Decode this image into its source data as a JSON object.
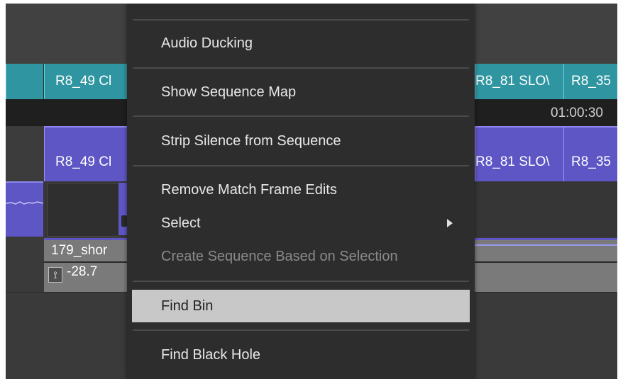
{
  "timeline": {
    "clips": {
      "v_left_1": "R8_49 Cl",
      "v_right_1a": "R8_81 SLO\\",
      "v_right_1b": "R8_35",
      "v_left_2": "R8_49 Cl",
      "v_right_2a": "R8_81 SLO\\",
      "v_right_2b": "R8_35",
      "audio_clip": "179_shor",
      "audio_gain": "-28.7"
    },
    "timecode": "01:00:30"
  },
  "context_menu": {
    "items": [
      {
        "label": "Audio Ducking",
        "state": "normal"
      },
      {
        "label": "Show Sequence Map",
        "state": "normal"
      },
      {
        "label": "Strip Silence from Sequence",
        "state": "normal"
      },
      {
        "label": "Remove Match Frame Edits",
        "state": "normal"
      },
      {
        "label": "Select",
        "state": "normal",
        "has_submenu": true
      },
      {
        "label": "Create Sequence Based on Selection",
        "state": "disabled"
      },
      {
        "label": "Find Bin",
        "state": "highlighted"
      },
      {
        "label": "Find Black Hole",
        "state": "normal"
      }
    ]
  },
  "colors": {
    "video_clip": "#2f96a1",
    "audio_clip": "#5f56c6",
    "menu_bg": "#2d2d2d",
    "menu_highlight": "#c8c8c8"
  }
}
